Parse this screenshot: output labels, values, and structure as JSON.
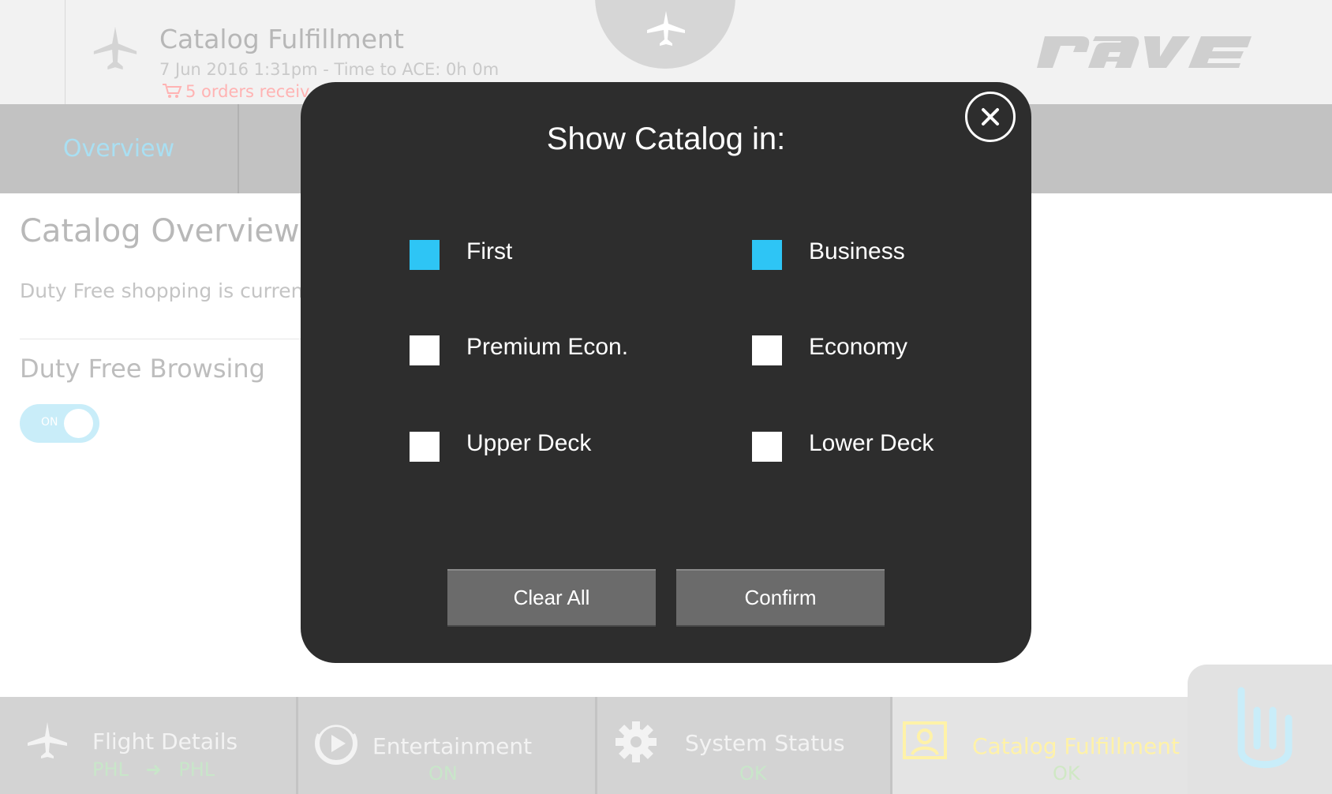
{
  "header": {
    "title": "Catalog Fulfillment",
    "datetime": "7 Jun 2016 1:31pm - Time to ACE: 0h 0m",
    "orders": "5 orders receiv",
    "logo_text": "rave",
    "plane_icon": "airplane-icon",
    "cart_icon": "cart-icon"
  },
  "tabs": {
    "overview": "Overview"
  },
  "content": {
    "title": "Catalog Overview",
    "description": "Duty Free shopping is current",
    "browse_label": "Duty Free Browsing",
    "toggle_text": "ON",
    "toggle_state": "on"
  },
  "modal": {
    "title": "Show Catalog in:",
    "options": [
      {
        "label": "First",
        "checked": true
      },
      {
        "label": "Business",
        "checked": true
      },
      {
        "label": "Premium Econ.",
        "checked": false
      },
      {
        "label": "Economy",
        "checked": false
      },
      {
        "label": "Upper Deck",
        "checked": false
      },
      {
        "label": "Lower Deck",
        "checked": false
      }
    ],
    "clear_label": "Clear All",
    "confirm_label": "Confirm"
  },
  "bottom_nav": {
    "flight": {
      "label": "Flight Details",
      "origin": "PHL",
      "destination": "PHL"
    },
    "entertainment": {
      "label": "Entertainment",
      "status": "ON"
    },
    "system": {
      "label": "System Status",
      "status": "OK"
    },
    "catalog": {
      "label": "Catalog Fulfillment",
      "status": "OK"
    }
  },
  "colors": {
    "accent": "#2ec5f5",
    "modal_bg": "#2d2d2d",
    "button_bg": "#6b6b6b",
    "active_label": "#fff2a8",
    "status_ok": "#c8e6c9"
  }
}
